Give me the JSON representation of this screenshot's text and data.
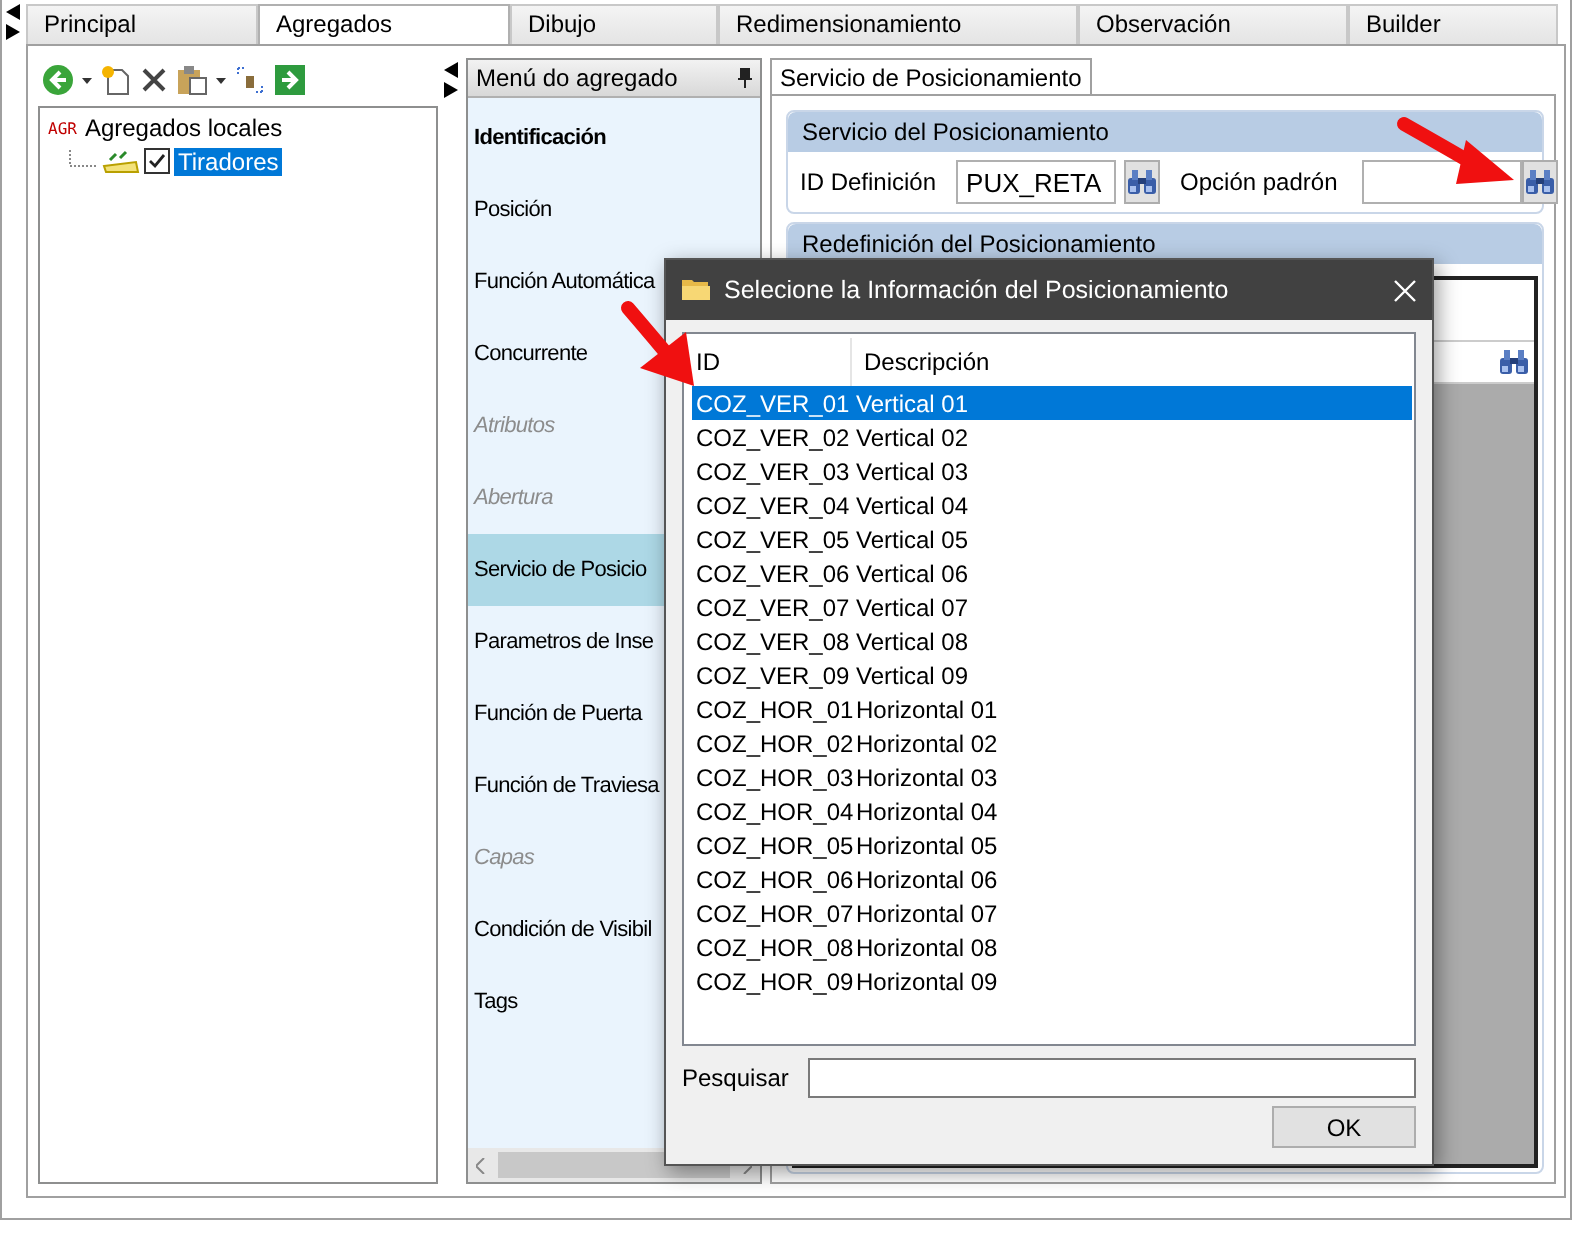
{
  "tabs": [
    {
      "label": "Principal",
      "selected": false
    },
    {
      "label": "Agregados",
      "selected": true
    },
    {
      "label": "Dibujo",
      "selected": false
    },
    {
      "label": "Redimensionamiento",
      "selected": false
    },
    {
      "label": "Observación",
      "selected": false
    },
    {
      "label": "Builder",
      "selected": false
    }
  ],
  "tree": {
    "items": [
      {
        "badge": "AGR",
        "label": "Agregados locales",
        "children": [
          {
            "label": "Tiradores",
            "checked": true,
            "selected": true
          }
        ]
      }
    ]
  },
  "menu": {
    "title": "Menú do agregado",
    "items": [
      {
        "label": "Identificación",
        "kind": "header",
        "selected": false,
        "disabled": false
      },
      {
        "label": "Posición",
        "kind": "item",
        "selected": false,
        "disabled": false
      },
      {
        "label": "Función Automática",
        "kind": "item",
        "selected": false,
        "disabled": false
      },
      {
        "label": "Concurrente",
        "kind": "item",
        "selected": false,
        "disabled": false
      },
      {
        "label": "Atributos",
        "kind": "item",
        "selected": false,
        "disabled": true
      },
      {
        "label": "Abertura",
        "kind": "item",
        "selected": false,
        "disabled": true
      },
      {
        "label": "Servicio de Posicio",
        "kind": "item",
        "selected": true,
        "disabled": false
      },
      {
        "label": "Parametros de Inse",
        "kind": "item",
        "selected": false,
        "disabled": false
      },
      {
        "label": "Función de Puerta",
        "kind": "item",
        "selected": false,
        "disabled": false
      },
      {
        "label": "Función de Traviesa",
        "kind": "item",
        "selected": false,
        "disabled": false
      },
      {
        "label": "Capas",
        "kind": "item",
        "selected": false,
        "disabled": true
      },
      {
        "label": "Condición de Visibil",
        "kind": "item",
        "selected": false,
        "disabled": false
      },
      {
        "label": "Tags",
        "kind": "item",
        "selected": false,
        "disabled": false
      }
    ]
  },
  "panel": {
    "tab": "Servicio de Posicionamiento",
    "service_group": {
      "title": "Servicio del Posicionamiento",
      "id_label": "ID Definición",
      "id_value": "PUX_RETA",
      "option_label": "Opción padrón"
    },
    "redefinition_group": {
      "title": "Redefinición del Posicionamiento"
    }
  },
  "dialog": {
    "title": "Selecione la Información del Posicionamiento",
    "columns": [
      "ID",
      "Descripción"
    ],
    "rows": [
      {
        "id": "COZ_VER_01",
        "description": "Vertical 01",
        "selected": true
      },
      {
        "id": "COZ_VER_02",
        "description": "Vertical 02",
        "selected": false
      },
      {
        "id": "COZ_VER_03",
        "description": "Vertical 03",
        "selected": false
      },
      {
        "id": "COZ_VER_04",
        "description": "Vertical 04",
        "selected": false
      },
      {
        "id": "COZ_VER_05",
        "description": "Vertical 05",
        "selected": false
      },
      {
        "id": "COZ_VER_06",
        "description": "Vertical 06",
        "selected": false
      },
      {
        "id": "COZ_VER_07",
        "description": "Vertical 07",
        "selected": false
      },
      {
        "id": "COZ_VER_08",
        "description": "Vertical 08",
        "selected": false
      },
      {
        "id": "COZ_VER_09",
        "description": "Vertical 09",
        "selected": false
      },
      {
        "id": "COZ_HOR_01",
        "description": "Horizontal 01",
        "selected": false
      },
      {
        "id": "COZ_HOR_02",
        "description": "Horizontal 02",
        "selected": false
      },
      {
        "id": "COZ_HOR_03",
        "description": "Horizontal 03",
        "selected": false
      },
      {
        "id": "COZ_HOR_04",
        "description": "Horizontal 04",
        "selected": false
      },
      {
        "id": "COZ_HOR_05",
        "description": "Horizontal 05",
        "selected": false
      },
      {
        "id": "COZ_HOR_06",
        "description": "Horizontal 06",
        "selected": false
      },
      {
        "id": "COZ_HOR_07",
        "description": "Horizontal 07",
        "selected": false
      },
      {
        "id": "COZ_HOR_08",
        "description": "Horizontal 08",
        "selected": false
      },
      {
        "id": "COZ_HOR_09",
        "description": "Horizontal 09",
        "selected": false
      }
    ],
    "search_label": "Pesquisar",
    "ok": "OK"
  }
}
